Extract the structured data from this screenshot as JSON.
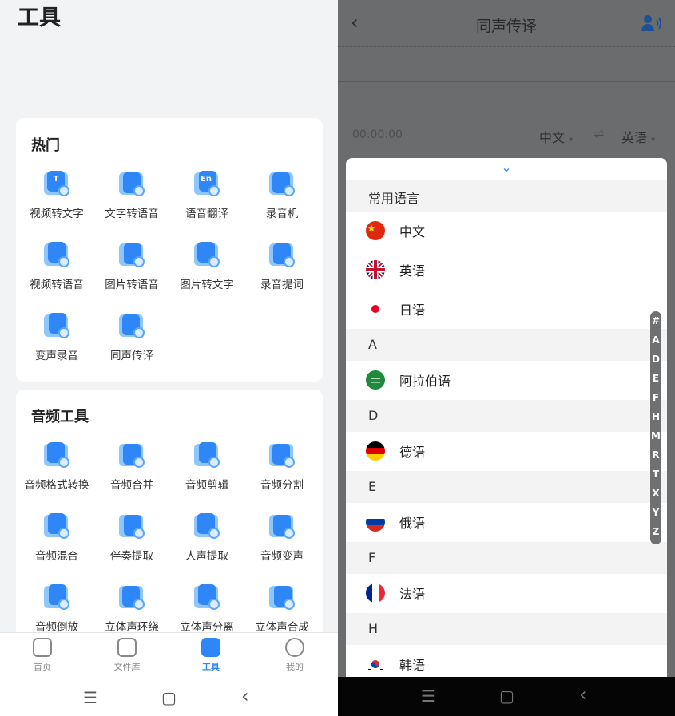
{
  "left": {
    "page_title": "工具",
    "hot": {
      "title": "热门",
      "tools": [
        {
          "label": "视频转文字",
          "icon": "video-to-text-icon",
          "glyph": "T"
        },
        {
          "label": "文字转语音",
          "icon": "text-to-speech-icon",
          "glyph": ""
        },
        {
          "label": "语音翻译",
          "icon": "speech-translate-icon",
          "glyph": "En"
        },
        {
          "label": "录音机",
          "icon": "recorder-icon",
          "glyph": ""
        },
        {
          "label": "视频转语音",
          "icon": "video-to-audio-icon",
          "glyph": ""
        },
        {
          "label": "图片转语音",
          "icon": "image-to-speech-icon",
          "glyph": ""
        },
        {
          "label": "图片转文字",
          "icon": "image-to-text-icon",
          "glyph": ""
        },
        {
          "label": "录音提词",
          "icon": "teleprompter-icon",
          "glyph": ""
        },
        {
          "label": "变声录音",
          "icon": "voice-changer-icon",
          "glyph": ""
        },
        {
          "label": "同声传译",
          "icon": "simultaneous-interpretation-icon",
          "glyph": ""
        }
      ]
    },
    "audio": {
      "title": "音频工具",
      "tools": [
        {
          "label": "音频格式转换",
          "icon": "audio-format-convert-icon"
        },
        {
          "label": "音频合并",
          "icon": "audio-merge-icon"
        },
        {
          "label": "音频剪辑",
          "icon": "audio-cut-icon"
        },
        {
          "label": "音频分割",
          "icon": "audio-split-icon"
        },
        {
          "label": "音频混合",
          "icon": "audio-mix-icon"
        },
        {
          "label": "伴奏提取",
          "icon": "accompaniment-extract-icon"
        },
        {
          "label": "人声提取",
          "icon": "vocal-extract-icon"
        },
        {
          "label": "音频变声",
          "icon": "audio-voice-change-icon"
        },
        {
          "label": "音频倒放",
          "icon": "audio-reverse-icon"
        },
        {
          "label": "立体声环绕",
          "icon": "stereo-surround-icon"
        },
        {
          "label": "立体声分离",
          "icon": "stereo-separate-icon"
        },
        {
          "label": "立体声合成",
          "icon": "stereo-synthesize-icon"
        }
      ]
    },
    "nav": [
      {
        "label": "首页",
        "icon": "home-icon",
        "active": false
      },
      {
        "label": "文件库",
        "icon": "folder-icon",
        "active": false
      },
      {
        "label": "工具",
        "icon": "toolbox-icon",
        "active": true
      },
      {
        "label": "我的",
        "icon": "profile-icon",
        "active": false
      }
    ],
    "system_nav": {
      "menu": "☰",
      "home": "▢",
      "back": "‹"
    }
  },
  "right": {
    "back": "‹",
    "title": "同声传译",
    "time": "00:00:00",
    "source_lang": "中文",
    "target_lang": "英语",
    "swap": "⇌",
    "dropdown_caret": "▾",
    "collapse_chevron": "⌄",
    "sections": [
      {
        "header": "常用语言",
        "items": [
          {
            "name": "中文",
            "flag": "cn"
          },
          {
            "name": "英语",
            "flag": "uk"
          },
          {
            "name": "日语",
            "flag": "jp"
          }
        ]
      },
      {
        "header": "A",
        "items": [
          {
            "name": "阿拉伯语",
            "flag": "sa"
          }
        ]
      },
      {
        "header": "D",
        "items": [
          {
            "name": "德语",
            "flag": "de"
          }
        ]
      },
      {
        "header": "E",
        "items": [
          {
            "name": "俄语",
            "flag": "ru"
          }
        ]
      },
      {
        "header": "F",
        "items": [
          {
            "name": "法语",
            "flag": "fr"
          }
        ]
      },
      {
        "header": "H",
        "items": [
          {
            "name": "韩语",
            "flag": "kr"
          }
        ]
      }
    ],
    "index_letters": [
      "#",
      "A",
      "D",
      "E",
      "F",
      "H",
      "M",
      "R",
      "T",
      "X",
      "Y",
      "Z"
    ],
    "system_nav": {
      "menu": "☰",
      "home": "▢",
      "back": "‹"
    }
  },
  "colors": {
    "accent": "#2f86f6",
    "overlay": "#6b6c6e"
  }
}
